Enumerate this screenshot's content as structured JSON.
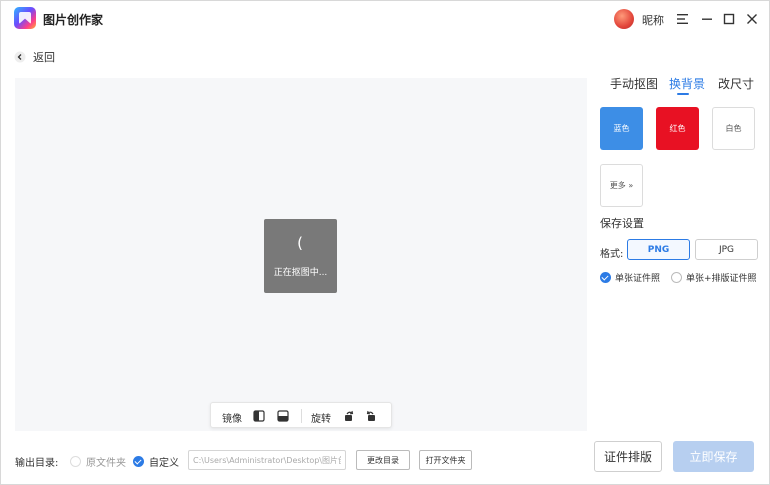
{
  "header": {
    "app_title": "图片创作家",
    "nickname": "昵称"
  },
  "nav": {
    "back_label": "返回"
  },
  "canvas": {
    "loading_text": "正在抠图中...",
    "spinner_glyph": "(",
    "toolbar": {
      "mirror_label": "镜像",
      "rotate_label": "旋转"
    }
  },
  "panel": {
    "tabs": [
      {
        "label": "手动抠图",
        "active": false
      },
      {
        "label": "换背景",
        "active": true
      },
      {
        "label": "改尺寸",
        "active": false
      }
    ],
    "backgrounds": [
      {
        "label": "蓝色",
        "color": "#3d8ee6"
      },
      {
        "label": "红色",
        "color": "#e81123"
      },
      {
        "label": "白色",
        "color": "#ffffff"
      },
      {
        "label": "更多 »",
        "color": "#ffffff"
      }
    ],
    "save_settings_title": "保存设置",
    "format_label": "格式:",
    "formats": [
      {
        "label": "PNG",
        "selected": true
      },
      {
        "label": "JPG",
        "selected": false
      }
    ],
    "layout_options": [
      {
        "label": "单张证件照",
        "checked": true
      },
      {
        "label": "单张+排版证件照",
        "checked": false
      }
    ]
  },
  "bottom": {
    "output_label": "输出目录:",
    "options": [
      {
        "label": "原文件夹",
        "checked": false
      },
      {
        "label": "自定义",
        "checked": true
      }
    ],
    "path_value": "C:\\Users\\Administrator\\Desktop\\图片创作",
    "change_dir_label": "更改目录",
    "open_folder_label": "打开文件夹",
    "id_layout_button": "证件排版",
    "save_now_button": "立即保存"
  },
  "colors": {
    "accent": "#2c7be5",
    "disabled_button": "#b7cff0"
  }
}
